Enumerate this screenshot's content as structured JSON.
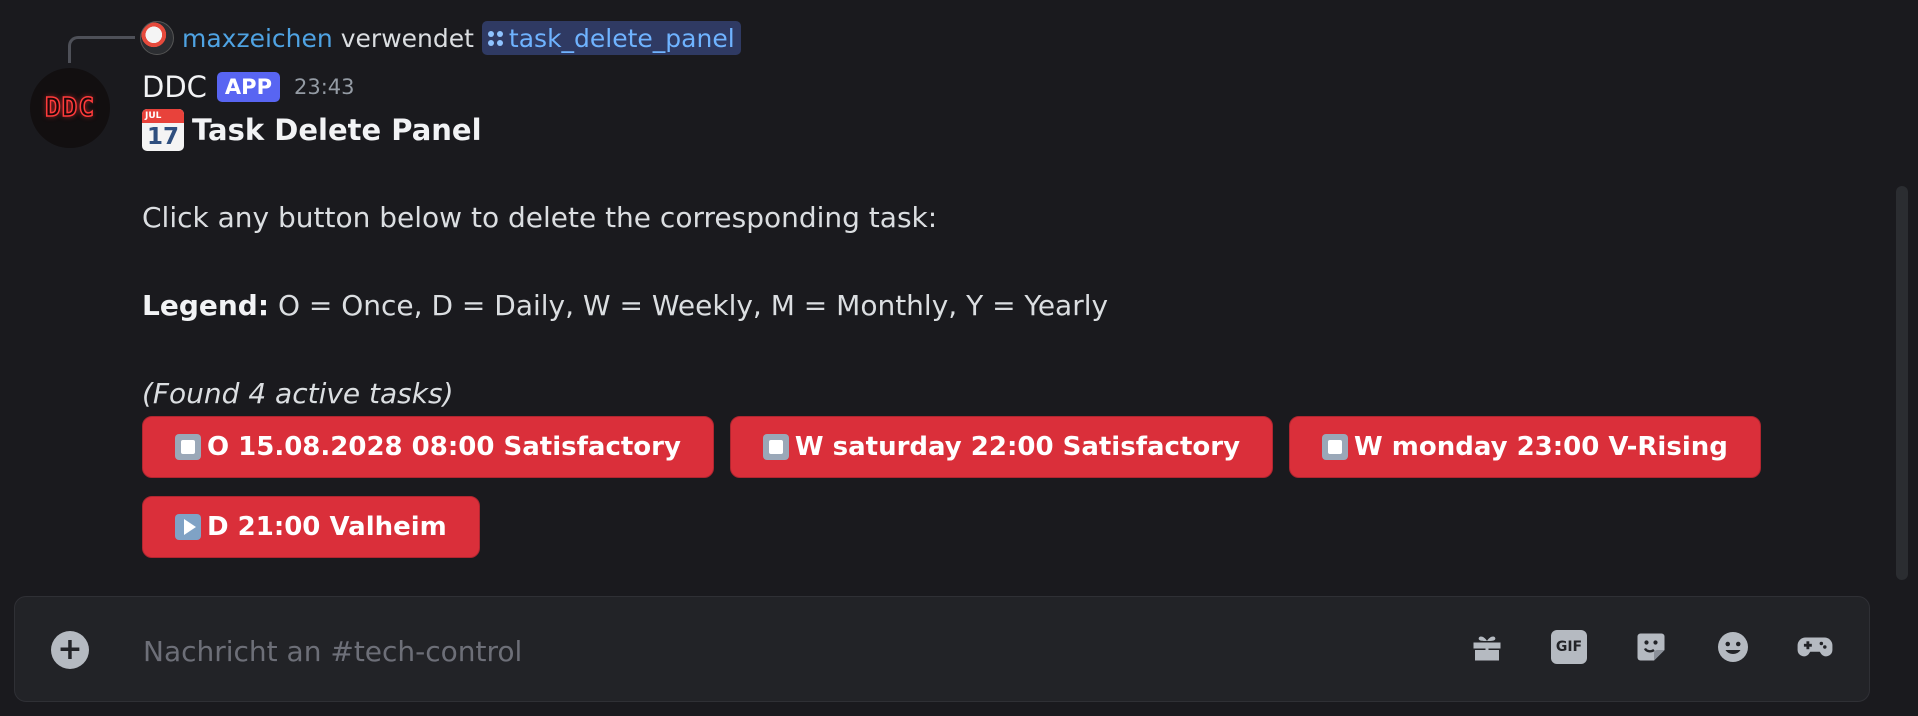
{
  "reply": {
    "username": "maxzeichen",
    "verb": "verwendet",
    "command": "task_delete_panel"
  },
  "message": {
    "avatar_text": "DDC",
    "author": "DDC",
    "badge": "APP",
    "timestamp": "23:43",
    "title": "Task Delete Panel",
    "calendar_icon": {
      "month": "JUL",
      "day": "17"
    },
    "instruction": "Click any button below to delete the corresponding task:",
    "legend_label": "Legend:",
    "legend_text": " O = Once, D = Daily, W = Weekly, M = Monthly, Y = Yearly",
    "found_text": "(Found 4 active tasks)",
    "buttons": [
      {
        "label": "O 15.08.2028 08:00 Satisfactory",
        "icon": "stop-icon"
      },
      {
        "label": "W saturday 22:00 Satisfactory",
        "icon": "stop-icon"
      },
      {
        "label": "W monday 23:00 V-Rising",
        "icon": "stop-icon"
      },
      {
        "label": "D 21:00 Valheim",
        "icon": "play-icon"
      }
    ]
  },
  "composer": {
    "placeholder": "Nachricht an #tech-control",
    "icons": [
      "gift-icon",
      "gif-icon",
      "sticker-icon",
      "emoji-icon",
      "activity-icon"
    ],
    "gif_label": "GIF"
  },
  "colors": {
    "background": "#1a1a1e",
    "danger_button": "#da2f3a",
    "app_badge": "#5865f2",
    "mention_link": "#4fa3e3"
  }
}
